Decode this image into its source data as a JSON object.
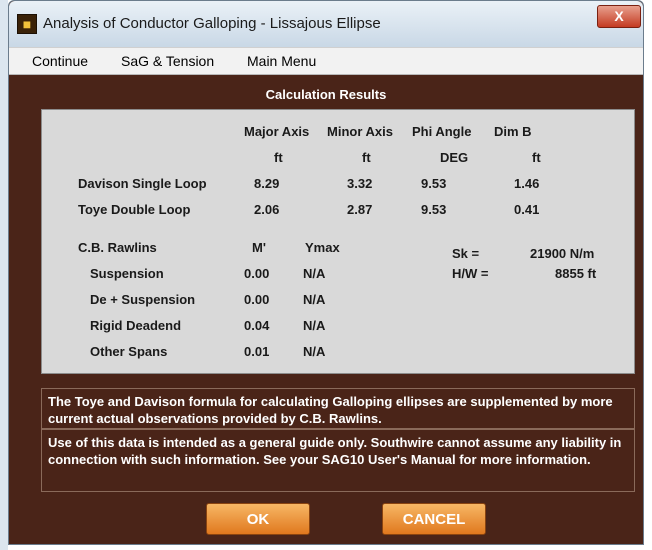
{
  "window": {
    "title": "Analysis of Conductor Galloping - Lissajous Ellipse",
    "close_label": "X"
  },
  "menu": [
    "Continue",
    "SaG & Tension",
    "Main Menu"
  ],
  "results": {
    "header": "Calculation Results",
    "columns": [
      {
        "name": "Major Axis",
        "unit": "ft"
      },
      {
        "name": "Minor Axis",
        "unit": "ft"
      },
      {
        "name": "Phi Angle",
        "unit": "DEG"
      },
      {
        "name": "Dim B",
        "unit": "ft"
      }
    ],
    "rows": [
      {
        "label": "Davison Single Loop",
        "values": [
          "8.29",
          "3.32",
          "9.53",
          "1.46"
        ]
      },
      {
        "label": "Toye Double Loop",
        "values": [
          "2.06",
          "2.87",
          "9.53",
          "0.41"
        ]
      }
    ],
    "rawlins": {
      "label": "C.B. Rawlins",
      "col_m": "M'",
      "col_ymax": "Ymax",
      "rows": [
        {
          "label": "Suspension",
          "m": "0.00",
          "ymax": "N/A"
        },
        {
          "label": "De + Suspension",
          "m": "0.00",
          "ymax": "N/A"
        },
        {
          "label": "Rigid Deadend",
          "m": "0.04",
          "ymax": "N/A"
        },
        {
          "label": "Other Spans",
          "m": "0.01",
          "ymax": "N/A"
        }
      ]
    },
    "sk_label": "Sk =",
    "sk_value": "21900 N/m",
    "hw_label": "H/W =",
    "hw_value": "8855 ft"
  },
  "notes": {
    "note1": "The Toye and Davison formula for calculating Galloping ellipses are supplemented by more current actual observations provided by C.B. Rawlins.",
    "note2": "Use of this data is intended as a general guide only. Southwire cannot assume any liability in connection with such information. See your SAG10 User's Manual for more information."
  },
  "buttons": {
    "ok": "OK",
    "cancel": "CANCEL"
  },
  "colors": {
    "background": "#4a2418",
    "panel": "#d9d9d9",
    "button": "#e98a2f"
  }
}
